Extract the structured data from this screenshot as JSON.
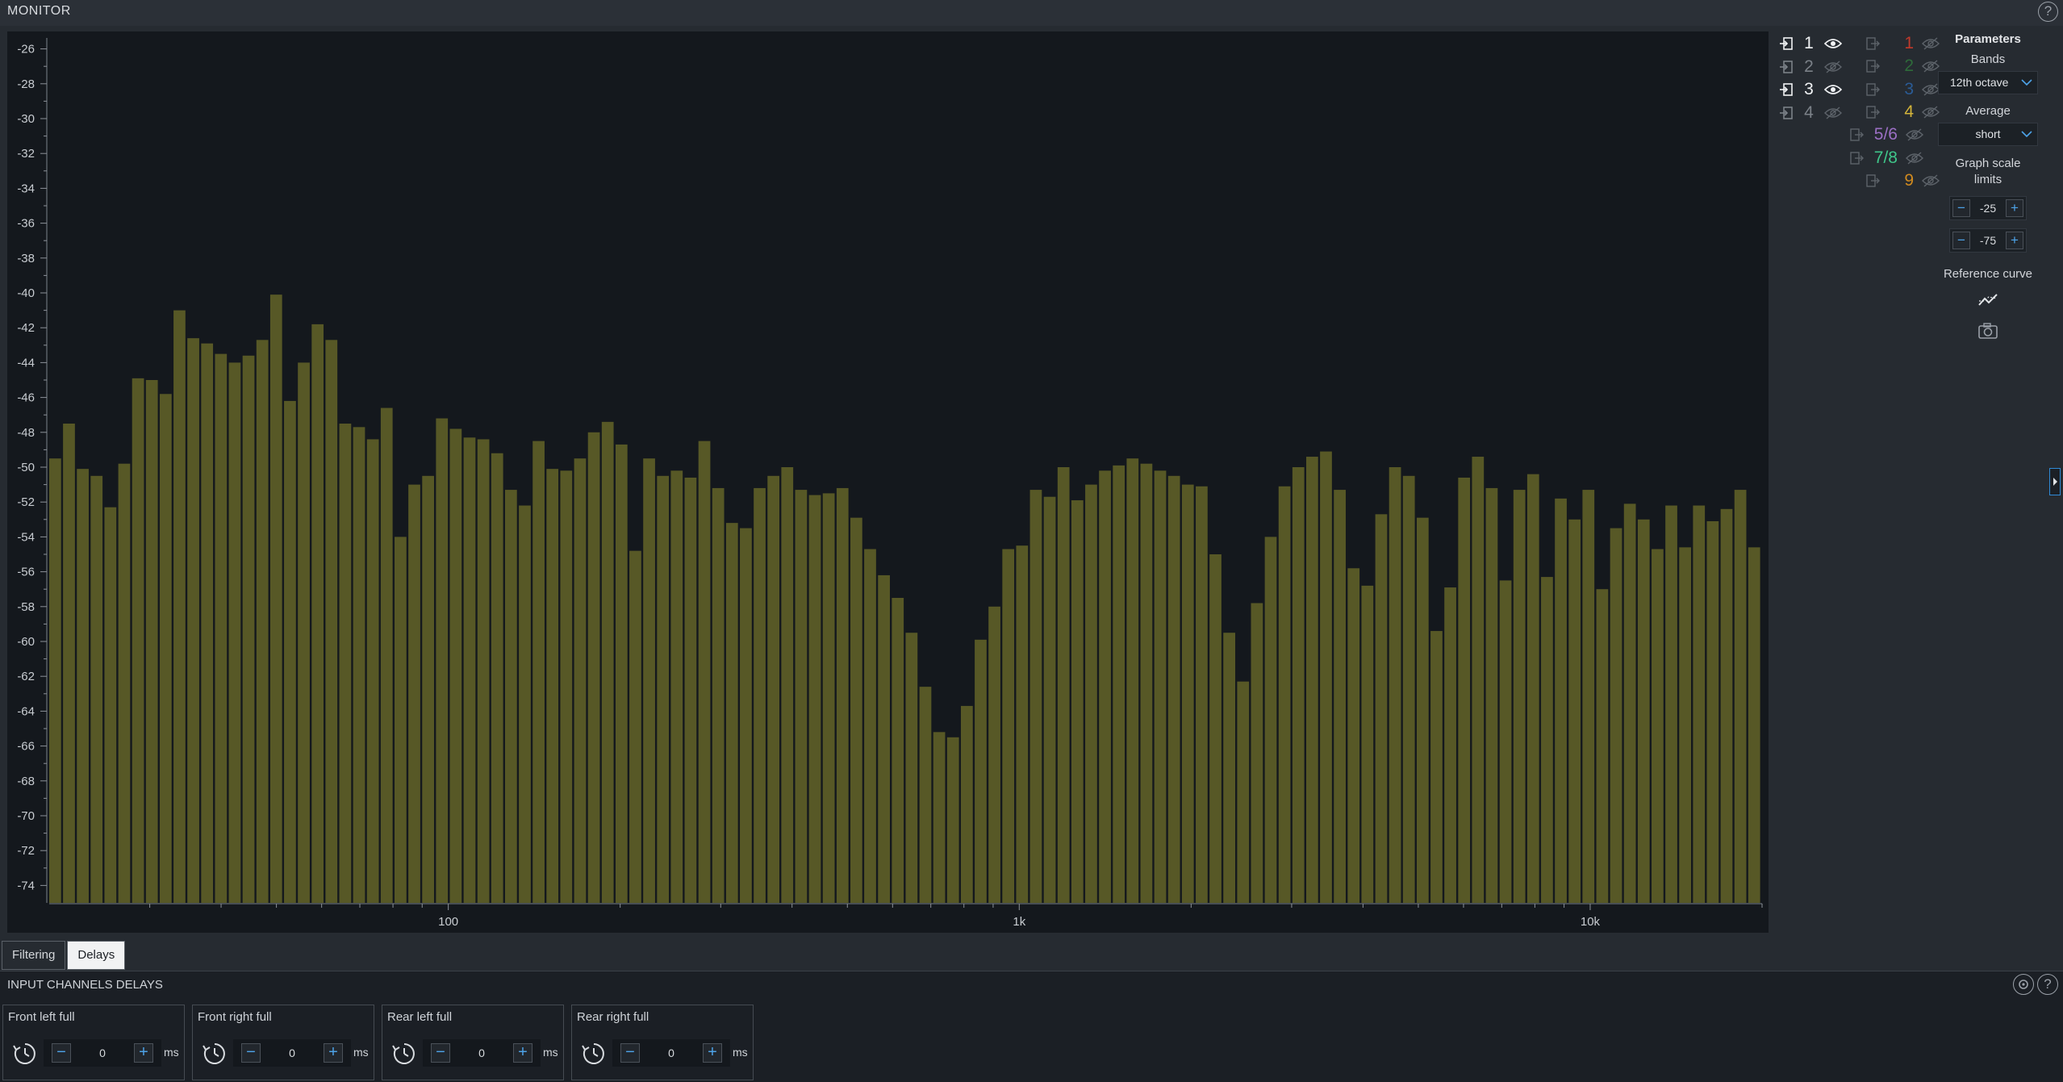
{
  "window": {
    "title": "MONITOR",
    "help_icon": "?"
  },
  "chart_data": {
    "type": "bar",
    "ylabel": "",
    "xlabel": "",
    "ylim": [
      -75,
      -25
    ],
    "y_ticks": [
      -26,
      -28,
      -30,
      -32,
      -34,
      -36,
      -38,
      -40,
      -42,
      -44,
      -46,
      -48,
      -50,
      -52,
      -54,
      -56,
      -58,
      -60,
      -62,
      -64,
      -66,
      -68,
      -70,
      -72,
      -74
    ],
    "x_scale": "log",
    "x_tick_labels": [
      {
        "value": 100,
        "label": "100"
      },
      {
        "value": 1000,
        "label": "1k"
      },
      {
        "value": 10000,
        "label": "10k"
      }
    ],
    "bar_color": "#575826",
    "series": [
      {
        "values": [
          -49.5,
          -47.5,
          -50.1,
          -50.5,
          -52.3,
          -49.8,
          -44.9,
          -45.0,
          -45.8,
          -41.0,
          -42.6,
          -42.9,
          -43.5,
          -44.0,
          -43.6,
          -42.7,
          -40.1,
          -46.2,
          -44.0,
          -41.8,
          -42.7,
          -47.5,
          -47.7,
          -48.4,
          -46.6,
          -54.0,
          -51.0,
          -50.5,
          -47.2,
          -47.8,
          -48.3,
          -48.4,
          -49.2,
          -51.3,
          -52.2,
          -48.5,
          -50.1,
          -50.2,
          -49.5,
          -48.0,
          -47.4,
          -48.7,
          -54.8,
          -49.5,
          -50.5,
          -50.2,
          -50.6,
          -48.5,
          -51.2,
          -53.2,
          -53.5,
          -51.2,
          -50.5,
          -50.0,
          -51.3,
          -51.6,
          -51.5,
          -51.2,
          -52.9,
          -54.7,
          -56.2,
          -57.5,
          -59.5,
          -62.6,
          -65.2,
          -65.5,
          -63.7,
          -59.9,
          -58.0,
          -54.7,
          -54.5,
          -51.3,
          -51.7,
          -50.0,
          -51.9,
          -51.0,
          -50.2,
          -49.9,
          -49.5,
          -49.8,
          -50.2,
          -50.5,
          -51.0,
          -51.1,
          -55.0,
          -59.5,
          -62.3,
          -57.8,
          -54.0,
          -51.1,
          -50.0,
          -49.4,
          -49.1,
          -51.3,
          -55.8,
          -56.8,
          -52.7,
          -50.0,
          -50.5,
          -52.9,
          -59.4,
          -56.9,
          -50.6,
          -49.4,
          -51.2,
          -56.5,
          -51.3,
          -50.4,
          -56.3,
          -51.8,
          -53.0,
          -51.3,
          -57.0,
          -53.5,
          -52.1,
          -53.0,
          -54.7,
          -52.2,
          -54.6,
          -52.2,
          -53.1,
          -52.4,
          -51.3,
          -54.6
        ]
      }
    ]
  },
  "inputs": [
    {
      "num": "1",
      "visible": true
    },
    {
      "num": "2",
      "visible": false
    },
    {
      "num": "3",
      "visible": true
    },
    {
      "num": "4",
      "visible": false
    }
  ],
  "outputs": [
    {
      "num": "1",
      "color": "#c0392b"
    },
    {
      "num": "2",
      "color": "#2e6b3a"
    },
    {
      "num": "3",
      "color": "#2a5b95"
    },
    {
      "num": "4",
      "color": "#d3b43a"
    },
    {
      "num": "5/6",
      "color": "#9b6fc4"
    },
    {
      "num": "7/8",
      "color": "#3fc68a"
    },
    {
      "num": "9",
      "color": "#d08a1f"
    }
  ],
  "params": {
    "title": "Parameters",
    "bands_label": "Bands",
    "bands_value": "12th octave",
    "average_label": "Average",
    "average_value": "short",
    "scale_label_1": "Graph scale",
    "scale_label_2": "limits",
    "scale_max": "-25",
    "scale_min": "-75",
    "reference_label": "Reference curve",
    "reference_icon": "reference-curve-icon",
    "snapshot_icon": "camera-icon"
  },
  "tabs": [
    {
      "label": "Filtering",
      "active": false
    },
    {
      "label": "Delays",
      "active": true
    }
  ],
  "delays": {
    "section_title": "INPUT CHANNELS DELAYS",
    "unit": "ms",
    "channels": [
      {
        "label": "Front left full",
        "value": "0"
      },
      {
        "label": "Front right full",
        "value": "0"
      },
      {
        "label": "Rear left full",
        "value": "0"
      },
      {
        "label": "Rear right full",
        "value": "0"
      }
    ]
  }
}
